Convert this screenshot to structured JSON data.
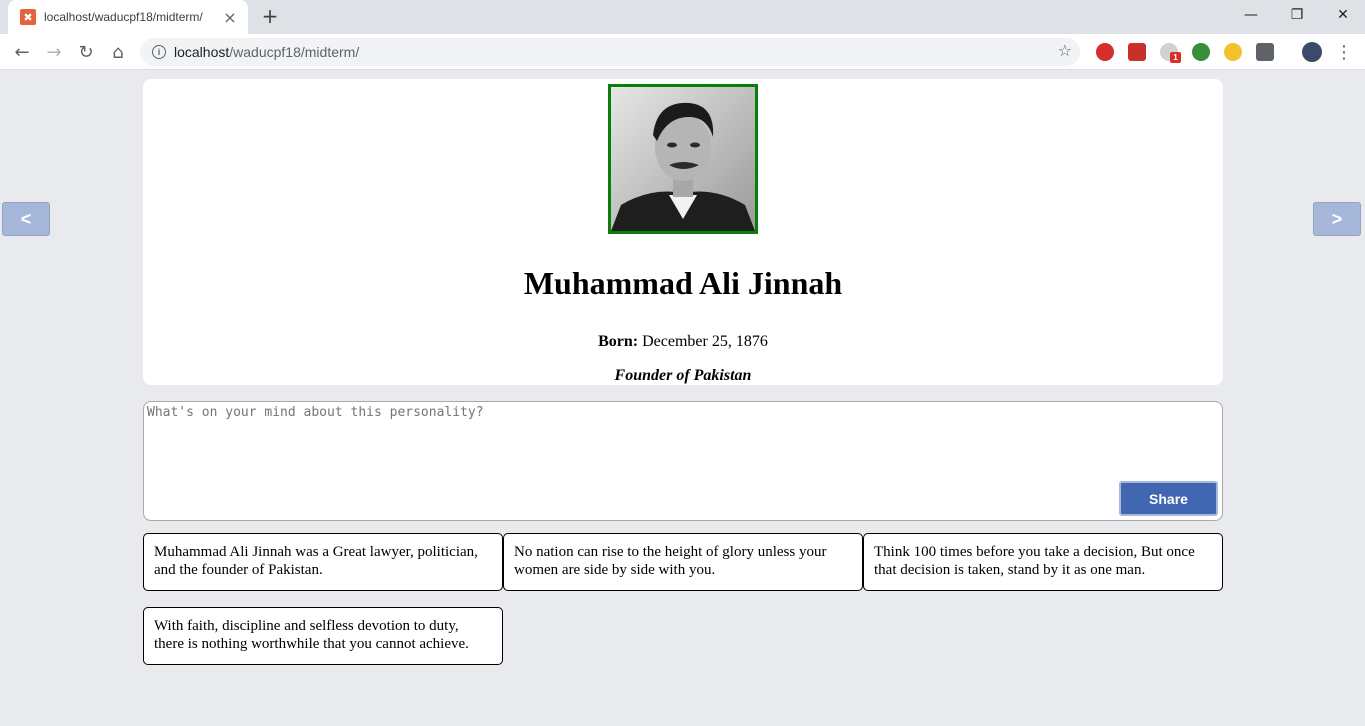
{
  "browser": {
    "tab_title": "localhost/waducpf18/midterm/",
    "url_host": "localhost",
    "url_path": "/waducpf18/midterm/",
    "extension_badge": "1"
  },
  "nav": {
    "prev_label": "<",
    "next_label": ">"
  },
  "profile": {
    "name": "Muhammad Ali Jinnah",
    "born_label": "Born:",
    "born_value": "December 25, 1876",
    "title": "Founder of Pakistan"
  },
  "composer": {
    "placeholder": "What's on your mind about this personality?",
    "value": "",
    "share_label": "Share"
  },
  "quotes": [
    "Muhammad Ali Jinnah was a Great lawyer, politician, and the founder of Pakistan.",
    "No nation can rise to the height of glory unless your women are side by side with you.",
    "Think 100 times before you take a decision, But once that decision is taken, stand by it as one man.",
    "With faith, discipline and selfless devotion to duty, there is nothing worthwhile that you cannot achieve."
  ],
  "colors": {
    "page_bg": "#e9eaee",
    "portrait_border": "#0a7d0a",
    "share_button": "#4267b2",
    "nav_arrow": "#a7b7d9"
  }
}
